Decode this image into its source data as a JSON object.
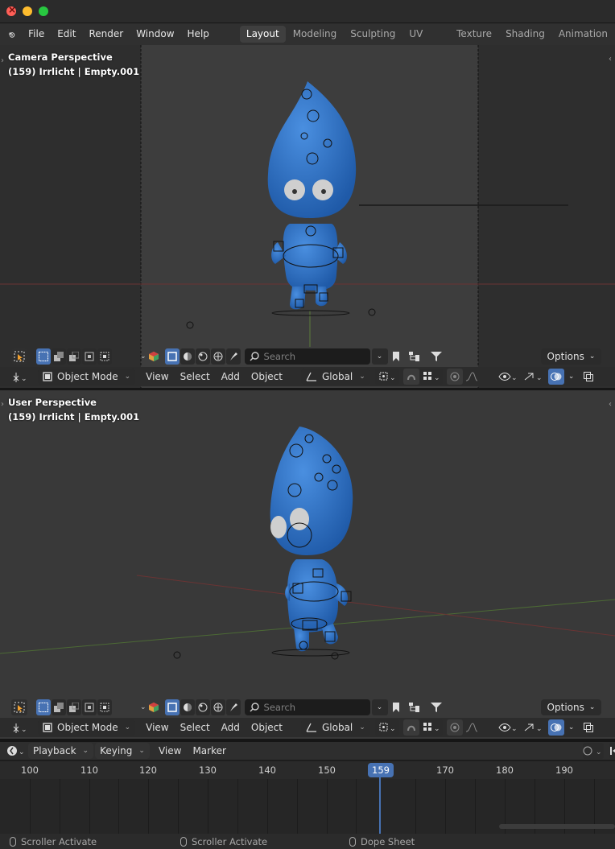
{
  "menubar": {
    "items": [
      "File",
      "Edit",
      "Render",
      "Window",
      "Help"
    ],
    "workspaces": [
      "Layout",
      "Modeling",
      "Sculpting",
      "UV Editing",
      "Texture Paint",
      "Shading",
      "Animation"
    ],
    "active_workspace": "Layout"
  },
  "viewport_top": {
    "title": "Camera Perspective",
    "subtitle": "(159) Irrlicht | Empty.001",
    "search_placeholder": "Search",
    "options_label": "Options",
    "mode_label": "Object Mode",
    "menus": [
      "View",
      "Select",
      "Add",
      "Object"
    ],
    "orientation_label": "Global"
  },
  "viewport_bottom": {
    "title": "User Perspective",
    "subtitle": "(159) Irrlicht | Empty.001",
    "search_placeholder": "Search",
    "options_label": "Options",
    "mode_label": "Object Mode",
    "menus": [
      "View",
      "Select",
      "Add",
      "Object"
    ],
    "orientation_label": "Global"
  },
  "timeline": {
    "menus": [
      "Playback",
      "Keying",
      "View",
      "Marker"
    ],
    "ticks": [
      100,
      110,
      120,
      130,
      140,
      150,
      170,
      180,
      190
    ],
    "current_frame": "159"
  },
  "statusbar": {
    "items": [
      "Scroller Activate",
      "Scroller Activate",
      "Dope Sheet"
    ]
  },
  "colors": {
    "accent": "#4772b3",
    "character": "#2f6fc0",
    "background": "#1d1d1d"
  }
}
